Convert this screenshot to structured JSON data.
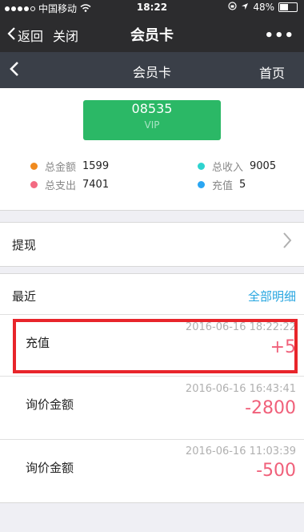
{
  "status": {
    "carrier": "中国移动",
    "time": "18:22",
    "battery": "48%",
    "battery_level": 0.48
  },
  "wechat": {
    "back_label": "返回",
    "close_label": "关闭",
    "title": "会员卡",
    "more_label": "•••"
  },
  "page": {
    "title": "会员卡",
    "home_label": "首页"
  },
  "card": {
    "number": "08535",
    "level": "VIP"
  },
  "stats": [
    {
      "label": "总金额",
      "value": "1599",
      "color": "#f08a1e"
    },
    {
      "label": "总收入",
      "value": "9005",
      "color": "#2ed3cf"
    },
    {
      "label": "总支出",
      "value": "7401",
      "color": "#f36a82"
    },
    {
      "label": "充值",
      "value": "5",
      "color": "#2aa6f2"
    }
  ],
  "withdraw": {
    "label": "提现"
  },
  "recent": {
    "label": "最近",
    "all_label": "全部明细",
    "items": [
      {
        "name": "充值",
        "time": "2016-06-16 18:22:22",
        "amount": "+5"
      },
      {
        "name": "询价金额",
        "time": "2016-06-16 16:43:41",
        "amount": "-2800"
      },
      {
        "name": "询价金额",
        "time": "2016-06-16 11:03:39",
        "amount": "-500"
      }
    ]
  }
}
